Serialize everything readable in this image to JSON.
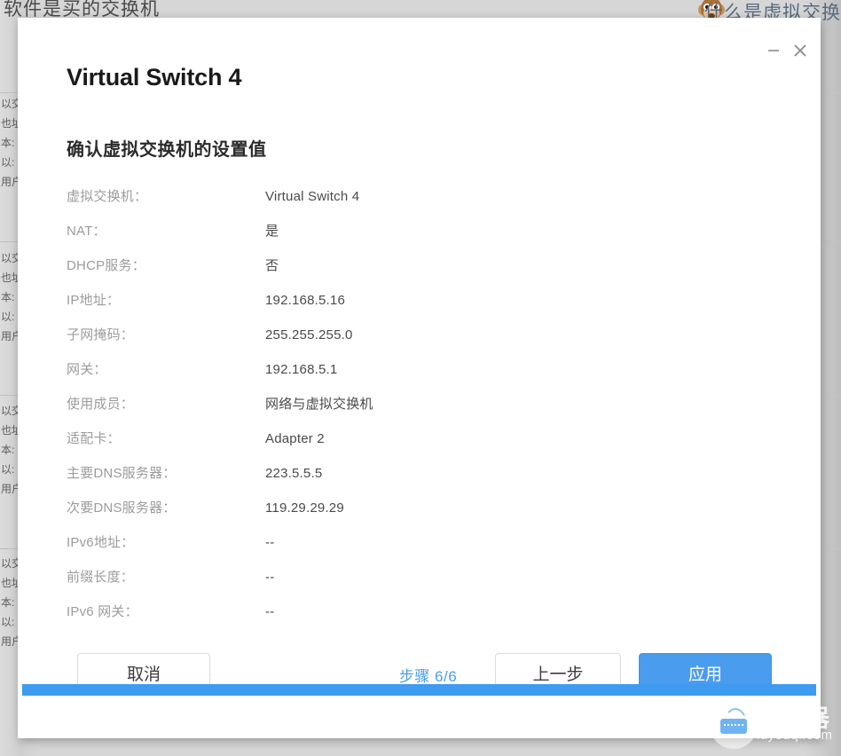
{
  "background": {
    "top_left_text": "软件是买的交换机",
    "top_right_text": "什么是虚拟交换",
    "side_text_lines": [
      "以交",
      "也址",
      "本:",
      "以:",
      "用户"
    ],
    "emoji": "monkey-face-emoji"
  },
  "dialog": {
    "title": "Virtual Switch 4",
    "subtitle": "确认虚拟交换机的设置值",
    "window_controls": {
      "minimize": "minimize-icon",
      "close": "close-icon"
    },
    "rows": [
      {
        "label": "虚拟交换机：",
        "value": "Virtual Switch 4"
      },
      {
        "label": "NAT：",
        "value": "是"
      },
      {
        "label": "DHCP服务：",
        "value": "否"
      },
      {
        "label": "IP地址：",
        "value": "192.168.5.16"
      },
      {
        "label": "子网掩码：",
        "value": "255.255.255.0"
      },
      {
        "label": "网关：",
        "value": "192.168.5.1"
      },
      {
        "label": "使用成员：",
        "value": "网络与虚拟交换机"
      },
      {
        "label": "适配卡：",
        "value": "Adapter 2"
      },
      {
        "label": "主要DNS服务器：",
        "value": "223.5.5.5"
      },
      {
        "label": "次要DNS服务器：",
        "value": "119.29.29.29"
      },
      {
        "label": "IPv6地址：",
        "value": "--"
      },
      {
        "label": "前缀长度：",
        "value": "--"
      },
      {
        "label": "IPv6 网关：",
        "value": "--"
      }
    ],
    "footer": {
      "cancel_label": "取消",
      "step_label": "步骤 6/6",
      "prev_label": "上一步",
      "apply_label": "应用"
    },
    "progress": {
      "percent": 100
    }
  },
  "watermark": {
    "title": "路由器",
    "subtitle": "luyouqi.com",
    "icon": "router-icon"
  },
  "colors": {
    "accent": "#4a9cef",
    "accent_border": "#3f93ef",
    "step_text": "#4a9cef",
    "progress": "#3f9bf0",
    "label_gray": "#9c9c9c",
    "value_gray": "#4a4a4a",
    "dialog_bg": "#ffffff",
    "page_bg": "#d6d6d6"
  }
}
